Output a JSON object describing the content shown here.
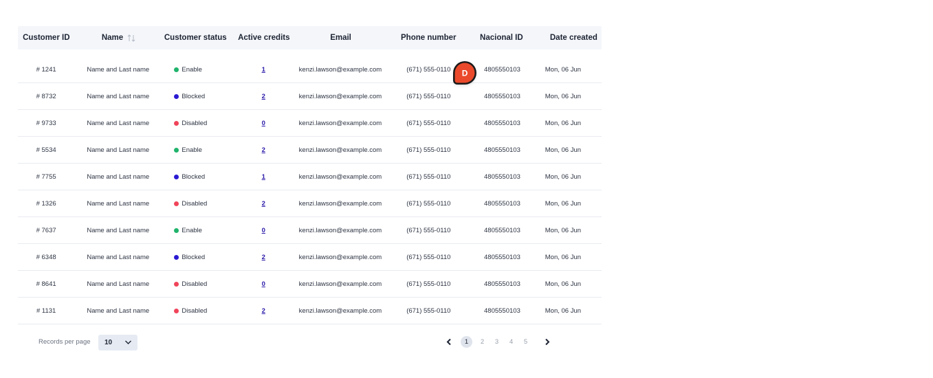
{
  "table": {
    "headers": {
      "customer_id": "Customer ID",
      "name": "Name",
      "customer_status": "Customer status",
      "active_credits": "Active credits",
      "email": "Email",
      "phone": "Phone number",
      "nacional_id": "Nacional ID",
      "date_created": "Date created"
    },
    "rows": [
      {
        "id": "# 1241",
        "name": "Name and Last name",
        "status": "Enable",
        "credits": "1",
        "email": "kenzi.lawson@example.com",
        "phone": "(671) 555-0110",
        "nid": "4805550103",
        "date": "Mon, 06 Jun"
      },
      {
        "id": "# 8732",
        "name": "Name and Last name",
        "status": "Blocked",
        "credits": "2",
        "email": "kenzi.lawson@example.com",
        "phone": "(671) 555-0110",
        "nid": "4805550103",
        "date": "Mon, 06 Jun"
      },
      {
        "id": "# 9733",
        "name": "Name and Last name",
        "status": "Disabled",
        "credits": "0",
        "email": "kenzi.lawson@example.com",
        "phone": "(671) 555-0110",
        "nid": "4805550103",
        "date": "Mon, 06 Jun"
      },
      {
        "id": "# 5534",
        "name": "Name and Last name",
        "status": "Enable",
        "credits": "2",
        "email": "kenzi.lawson@example.com",
        "phone": "(671) 555-0110",
        "nid": "4805550103",
        "date": "Mon, 06 Jun"
      },
      {
        "id": "# 7755",
        "name": "Name and Last name",
        "status": "Blocked",
        "credits": "1",
        "email": "kenzi.lawson@example.com",
        "phone": "(671) 555-0110",
        "nid": "4805550103",
        "date": "Mon, 06 Jun"
      },
      {
        "id": "# 1326",
        "name": "Name and Last name",
        "status": "Disabled",
        "credits": "2",
        "email": "kenzi.lawson@example.com",
        "phone": "(671) 555-0110",
        "nid": "4805550103",
        "date": "Mon, 06 Jun"
      },
      {
        "id": "# 7637",
        "name": "Name and Last name",
        "status": "Enable",
        "credits": "0",
        "email": "kenzi.lawson@example.com",
        "phone": "(671) 555-0110",
        "nid": "4805550103",
        "date": "Mon, 06 Jun"
      },
      {
        "id": "# 6348",
        "name": "Name and Last name",
        "status": "Blocked",
        "credits": "2",
        "email": "kenzi.lawson@example.com",
        "phone": "(671) 555-0110",
        "nid": "4805550103",
        "date": "Mon, 06 Jun"
      },
      {
        "id": "# 8641",
        "name": "Name and Last name",
        "status": "Disabled",
        "credits": "0",
        "email": "kenzi.lawson@example.com",
        "phone": "(671) 555-0110",
        "nid": "4805550103",
        "date": "Mon, 06 Jun"
      },
      {
        "id": "# 1131",
        "name": "Name and Last name",
        "status": "Disabled",
        "credits": "2",
        "email": "kenzi.lawson@example.com",
        "phone": "(671) 555-0110",
        "nid": "4805550103",
        "date": "Mon, 06 Jun"
      }
    ]
  },
  "status_colors": {
    "Enable": "#1fb36b",
    "Blocked": "#2a1ad1",
    "Disabled": "#f0445a"
  },
  "cursor_avatar": {
    "initial": "D",
    "color": "#ea4a2b"
  },
  "footer": {
    "records_per_page_label": "Records per page",
    "records_per_page_value": "10",
    "pages": [
      "1",
      "2",
      "3",
      "4",
      "5"
    ],
    "current_page": "1"
  },
  "icons": {
    "sort": "sort-arrows-icon",
    "select": "chevron-down-icon",
    "prev": "chevron-left-icon",
    "next": "chevron-right-icon"
  }
}
